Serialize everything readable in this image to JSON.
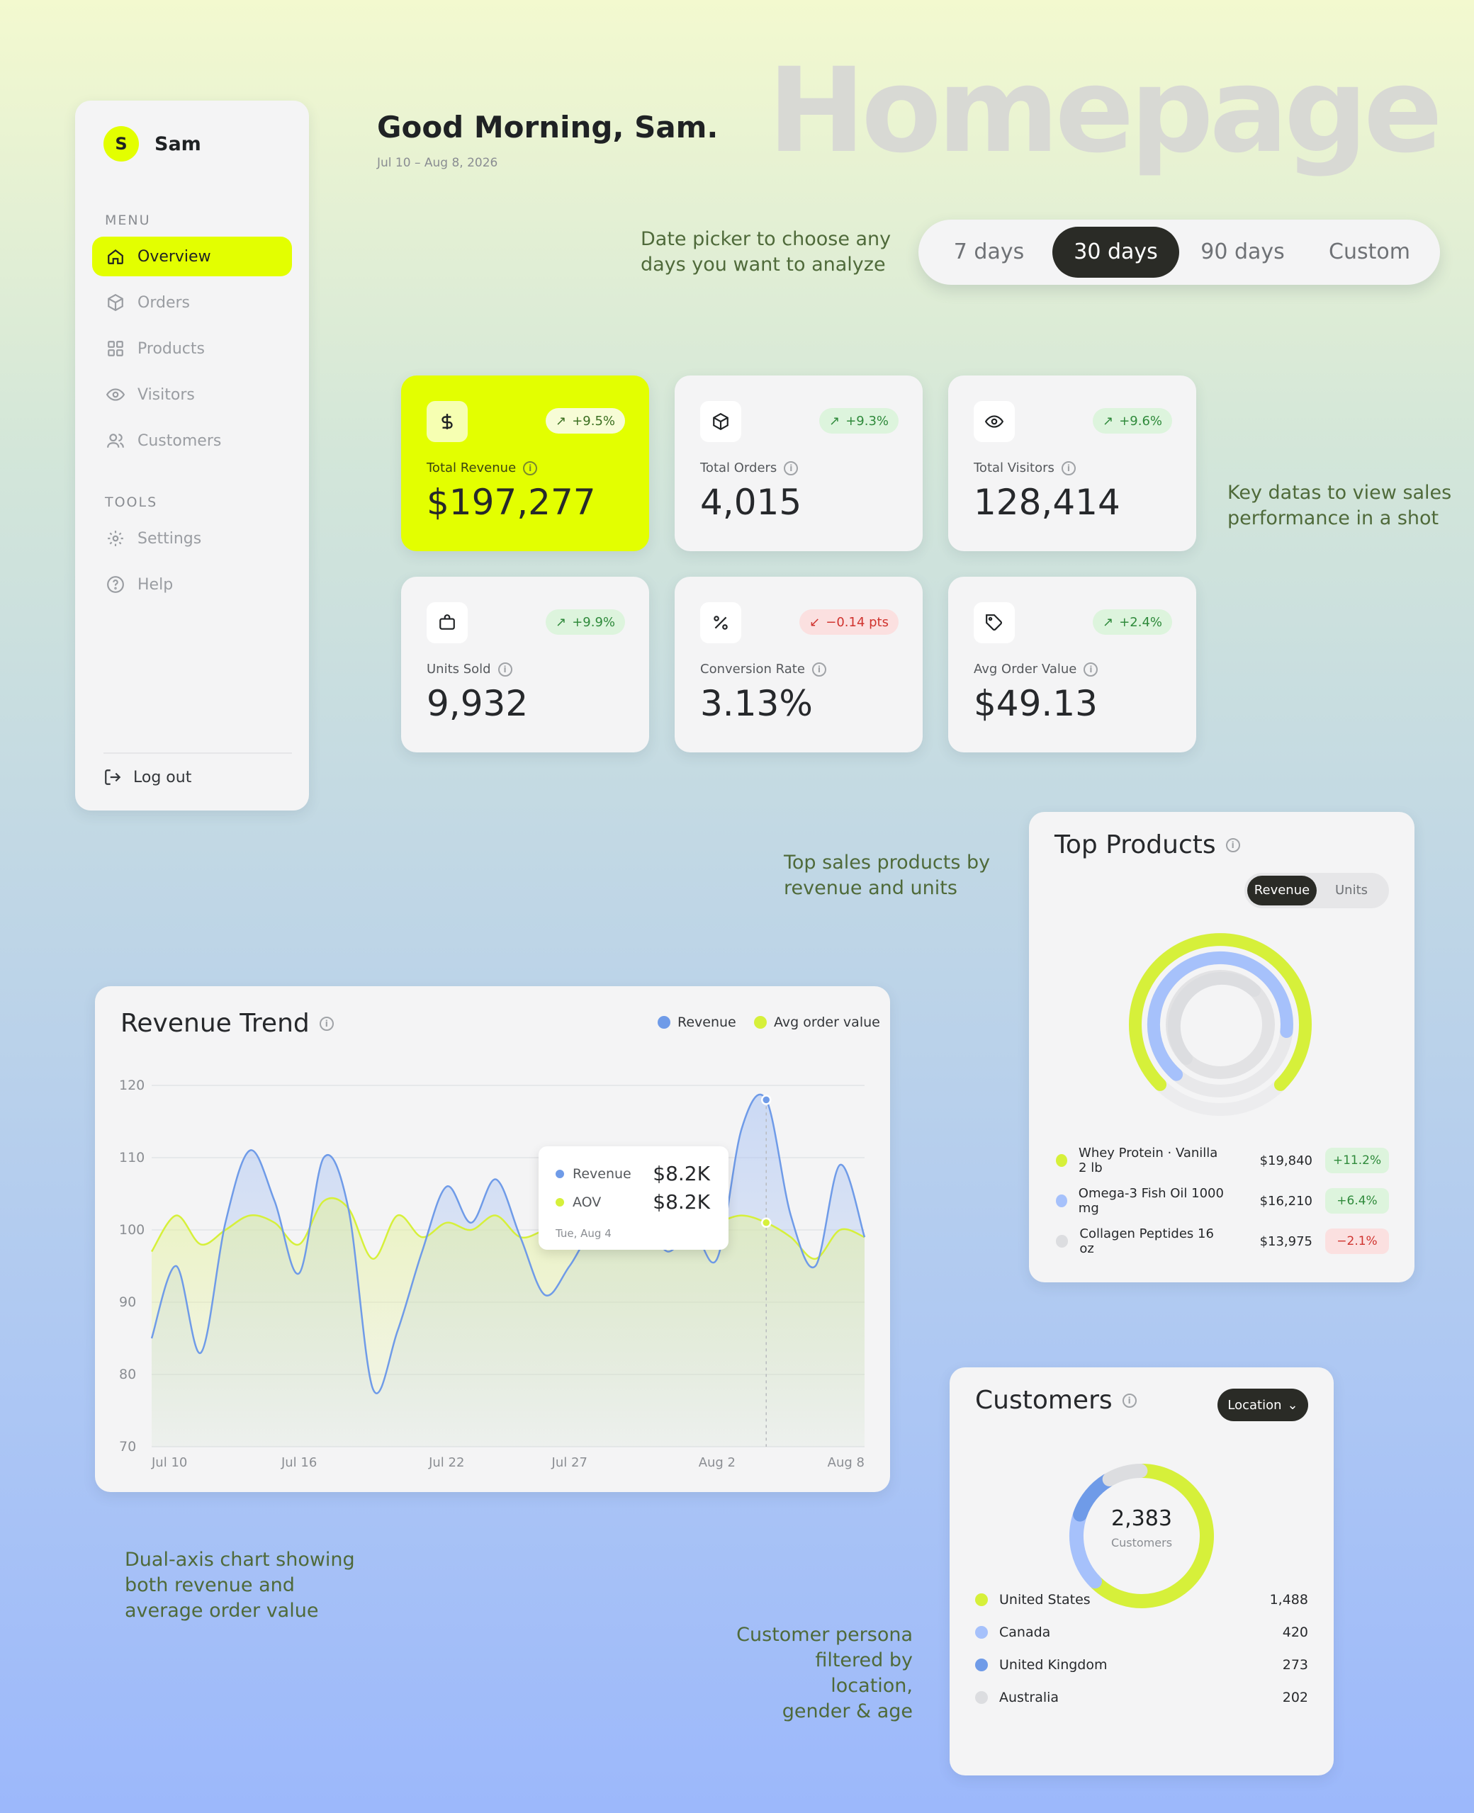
{
  "page_title": "Homepage",
  "user": {
    "initial": "S",
    "name": "Sam"
  },
  "sidebar": {
    "menu_label": "MENU",
    "menu_items": [
      {
        "label": "Overview",
        "icon": "home-icon",
        "active": true
      },
      {
        "label": "Orders",
        "icon": "box-icon"
      },
      {
        "label": "Products",
        "icon": "grid-icon"
      },
      {
        "label": "Visitors",
        "icon": "eye-icon"
      },
      {
        "label": "Customers",
        "icon": "users-icon"
      }
    ],
    "tools_label": "TOOLS",
    "tool_items": [
      {
        "label": "Settings",
        "icon": "gear-icon"
      },
      {
        "label": "Help",
        "icon": "help-icon"
      }
    ],
    "logout": "Log out"
  },
  "header": {
    "greeting": "Good Morning, Sam.",
    "date_range": "Jul 10 – Aug 8, 2026"
  },
  "date_picker": {
    "options": [
      "7 days",
      "30 days",
      "90 days",
      "Custom"
    ],
    "selected": "30 days"
  },
  "notes": {
    "date_picker": [
      "Date picker to choose any",
      "days you want to analyze"
    ],
    "kpis": [
      "Key datas to view sales",
      "performance in a shot"
    ],
    "products": [
      "Top sales products by",
      "revenue and units"
    ],
    "trend": [
      "Dual-axis chart showing",
      "both revenue and",
      "average order value"
    ],
    "customers": [
      "Customer persona",
      "filtered by location,",
      "gender & age"
    ]
  },
  "kpis": [
    {
      "label": "Total Revenue",
      "value": "$197,277",
      "change": "+9.5%",
      "direction": "up",
      "icon": "dollar-icon"
    },
    {
      "label": "Total Orders",
      "value": "4,015",
      "change": "+9.3%",
      "direction": "up",
      "icon": "box-icon"
    },
    {
      "label": "Total Visitors",
      "value": "128,414",
      "change": "+9.6%",
      "direction": "up",
      "icon": "eye-icon"
    },
    {
      "label": "Units Sold",
      "value": "9,932",
      "change": "+9.9%",
      "direction": "up",
      "icon": "bag-icon"
    },
    {
      "label": "Conversion Rate",
      "value": "3.13%",
      "change": "−0.14 pts",
      "direction": "down",
      "icon": "percent-icon"
    },
    {
      "label": "Avg Order Value",
      "value": "$49.13",
      "change": "+2.4%",
      "direction": "up",
      "icon": "tag-icon"
    }
  ],
  "revenue_trend": {
    "title": "Revenue Trend",
    "legend": [
      "Revenue",
      "Avg order value"
    ],
    "tooltip": {
      "rows": [
        {
          "label": "Revenue",
          "value": "$8.2K"
        },
        {
          "label": "AOV",
          "value": "$8.2K"
        }
      ],
      "date": "Tue, Aug 4"
    }
  },
  "chart_data": {
    "type": "area",
    "title": "Revenue Trend",
    "x_tick_labels": [
      "Jul 10",
      "Jul 16",
      "Jul 22",
      "Jul 27",
      "Aug 2",
      "Aug 8"
    ],
    "y_tick_labels": [
      "120",
      "110",
      "100",
      "90",
      "80",
      "70"
    ],
    "ylim": [
      70,
      120
    ],
    "grid": true,
    "legend_position": "top-right",
    "x": [
      "Jul 10",
      "Jul 11",
      "Jul 12",
      "Jul 13",
      "Jul 14",
      "Jul 15",
      "Jul 16",
      "Jul 17",
      "Jul 18",
      "Jul 19",
      "Jul 20",
      "Jul 21",
      "Jul 22",
      "Jul 23",
      "Jul 24",
      "Jul 25",
      "Jul 26",
      "Jul 27",
      "Jul 28",
      "Jul 29",
      "Jul 30",
      "Jul 31",
      "Aug 1",
      "Aug 2",
      "Aug 3",
      "Aug 4",
      "Aug 5",
      "Aug 6",
      "Aug 7",
      "Aug 8"
    ],
    "series": [
      {
        "name": "Revenue",
        "color": "#6f9be8",
        "values": [
          85,
          95,
          83,
          101,
          111,
          104,
          94,
          110,
          103,
          78,
          86,
          97,
          106,
          101,
          107,
          99,
          91,
          95,
          100,
          98,
          101,
          97,
          100,
          96,
          114,
          118,
          102,
          95,
          109,
          99
        ]
      },
      {
        "name": "Avg order value",
        "color": "#d6f03a",
        "values": [
          97,
          102,
          98,
          100,
          102,
          101,
          98,
          104,
          103,
          96,
          102,
          99,
          101,
          100,
          102,
          99,
          100,
          101,
          102,
          98,
          101,
          99,
          100,
          101,
          102,
          101,
          99,
          96,
          100,
          99
        ]
      }
    ],
    "highlight": {
      "x": "Aug 4",
      "series_values": [
        "$8.2K",
        "$8.2K"
      ]
    }
  },
  "top_products": {
    "title": "Top Products",
    "toggle": [
      "Revenue",
      "Units"
    ],
    "toggle_selected": "Revenue",
    "items": [
      {
        "name": "Whey Protein · Vanilla 2 lb",
        "revenue": "$19,840",
        "change": "+11.2%",
        "direction": "up",
        "color": "#d6f03a",
        "share": 0.75
      },
      {
        "name": "Omega-3 Fish Oil 1000 mg",
        "revenue": "$16,210",
        "change": "+6.4%",
        "direction": "up",
        "color": "#a6c1fb",
        "share": 0.6
      },
      {
        "name": "Collagen Peptides 16 oz",
        "revenue": "$13,975",
        "change": "−2.1%",
        "direction": "down",
        "color": "#dcdde0",
        "share": 0.45
      }
    ]
  },
  "customers": {
    "title": "Customers",
    "filter": "Location",
    "total": "2,383",
    "total_label": "Customers",
    "items": [
      {
        "name": "United States",
        "count": 1488,
        "count_label": "1,488",
        "color": "#d6f03a"
      },
      {
        "name": "Canada",
        "count": 420,
        "count_label": "420",
        "color": "#a6c1fb"
      },
      {
        "name": "United Kingdom",
        "count": 273,
        "count_label": "273",
        "color": "#6f9be8"
      },
      {
        "name": "Australia",
        "count": 202,
        "count_label": "202",
        "color": "#dcdde0"
      }
    ]
  }
}
